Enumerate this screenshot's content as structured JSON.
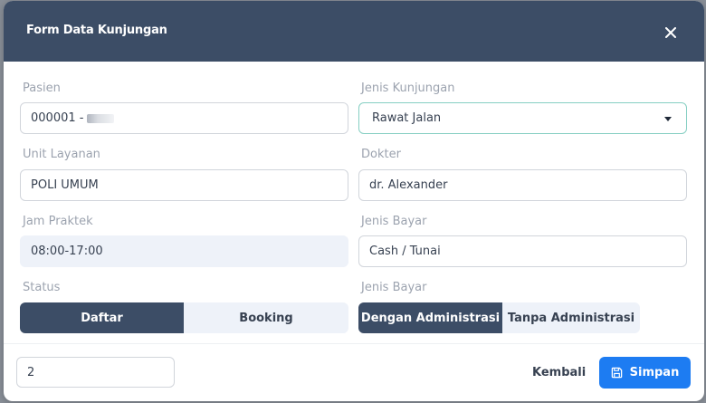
{
  "modal": {
    "title": "Form Data Kunjungan",
    "close_icon": "close-icon"
  },
  "fields": {
    "pasien": {
      "label": "Pasien",
      "value": "000001 - "
    },
    "jenis_kunjungan": {
      "label": "Jenis Kunjungan",
      "value": "Rawat Jalan"
    },
    "unit_layanan": {
      "label": "Unit Layanan",
      "value": "POLI UMUM"
    },
    "dokter": {
      "label": "Dokter",
      "value": "dr. Alexander"
    },
    "jam_praktek": {
      "label": "Jam Praktek",
      "value": "08:00-17:00"
    },
    "jenis_bayar": {
      "label": "Jenis Bayar",
      "value": "Cash / Tunai"
    }
  },
  "status": {
    "label": "Status",
    "options": [
      "Daftar",
      "Booking"
    ],
    "selected": "Daftar"
  },
  "administrasi": {
    "label": "Jenis Bayar",
    "options": [
      "Dengan Administrasi",
      "Tanpa Administrasi"
    ],
    "selected": "Dengan Administrasi"
  },
  "footer": {
    "input_value": "2",
    "back_label": "Kembali",
    "save_label": "Simpan",
    "save_icon": "floppy-disk-icon"
  },
  "colors": {
    "header": "#3c4d66",
    "primary_button": "#1d7cf2",
    "readonly_bg": "#eef2f9",
    "select_border": "#86cfc3"
  }
}
